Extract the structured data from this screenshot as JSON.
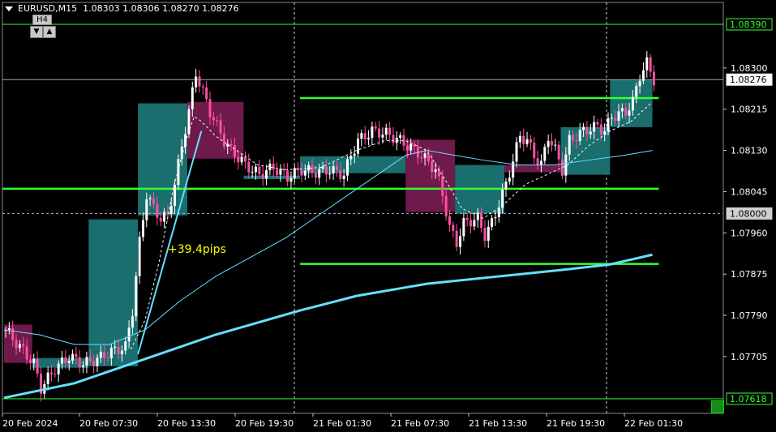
{
  "header": {
    "symbol_tf": "EURUSD,M15",
    "ohlc": "1.08303 1.08306 1.08270 1.08276"
  },
  "timeframe_button": {
    "label": "H4",
    "down_glyph": "▼",
    "up_glyph": "▲"
  },
  "annotation": {
    "text": "+39.4pips",
    "color": "#ffff00"
  },
  "colors": {
    "background": "#000000",
    "bull_candle": "#ffffff",
    "bear_candle": "#ff4fa3",
    "bull_box": "#1a6e6e",
    "bear_box": "#6e1a4a",
    "ma_color": "#66e0ff",
    "level_line": "#33ff33",
    "price_line": "#9aa7b8"
  },
  "chart_data": {
    "type": "candlestick",
    "symbol": "EURUSD",
    "timeframe": "M15",
    "ylim": [
      1.0758,
      1.0847
    ],
    "y_ticks": [
      "1.08300",
      "1.08215",
      "1.08130",
      "1.08045",
      "1.07960",
      "1.07875",
      "1.07790",
      "1.07705"
    ],
    "x_tick_labels": [
      "20 Feb 2024",
      "20 Feb 07:30",
      "20 Feb 13:30",
      "20 Feb 19:30",
      "21 Feb 01:30",
      "21 Feb 07:30",
      "21 Feb 13:30",
      "21 Feb 19:30",
      "22 Feb 01:30"
    ],
    "price_labels": [
      {
        "text": "1.08390",
        "value": 1.0839,
        "style": "green"
      },
      {
        "text": "1.08276",
        "value": 1.08276,
        "style": "current"
      },
      {
        "text": "1.08000",
        "value": 1.08,
        "style": "gray"
      },
      {
        "text": "1.07618",
        "value": 1.07618,
        "style": "green"
      }
    ],
    "horizontal_levels": [
      {
        "value": 1.0839,
        "kind": "thin-green"
      },
      {
        "value": 1.07618,
        "kind": "thin-green"
      },
      {
        "value": 1.08051,
        "kind": "bold-green",
        "from_bar": 0,
        "to_bar": 184
      },
      {
        "value": 1.08238,
        "kind": "bold-green",
        "from_bar": 84,
        "to_bar": 184
      },
      {
        "value": 1.07896,
        "kind": "bold-green",
        "from_bar": 84,
        "to_bar": 184
      },
      {
        "value": 1.08276,
        "kind": "price-line"
      },
      {
        "value": 1.08,
        "kind": "dotted"
      }
    ],
    "h4_boxes": [
      {
        "from_bar": 0,
        "to_bar": 8,
        "open": 1.07771,
        "close": 1.07692,
        "high": 1.078,
        "low": 1.0762
      },
      {
        "from_bar": 8,
        "to_bar": 24,
        "open": 1.07682,
        "close": 1.07702,
        "high": 1.0772,
        "low": 1.0764
      },
      {
        "from_bar": 24,
        "to_bar": 38,
        "open": 1.07685,
        "close": 1.07988,
        "high": 1.08,
        "low": 1.0768
      },
      {
        "from_bar": 38,
        "to_bar": 52,
        "open": 1.07996,
        "close": 1.08227,
        "high": 1.0838,
        "low": 1.0795
      },
      {
        "from_bar": 52,
        "to_bar": 68,
        "open": 1.0823,
        "close": 1.08113,
        "high": 1.08305,
        "low": 1.0808
      },
      {
        "from_bar": 68,
        "to_bar": 84,
        "open": 1.08071,
        "close": 1.08078,
        "high": 1.0812,
        "low": 1.0805
      },
      {
        "from_bar": 84,
        "to_bar": 114,
        "open": 1.08083,
        "close": 1.08118,
        "high": 1.0818,
        "low": 1.0804
      },
      {
        "from_bar": 114,
        "to_bar": 128,
        "open": 1.08152,
        "close": 1.08003,
        "high": 1.0817,
        "low": 1.0789
      },
      {
        "from_bar": 128,
        "to_bar": 142,
        "open": 1.08,
        "close": 1.081,
        "high": 1.0816,
        "low": 1.079
      },
      {
        "from_bar": 142,
        "to_bar": 158,
        "open": 1.081,
        "close": 1.08085,
        "high": 1.0819,
        "low": 1.0803
      },
      {
        "from_bar": 158,
        "to_bar": 172,
        "open": 1.0808,
        "close": 1.08178,
        "high": 1.0824,
        "low": 1.08
      },
      {
        "from_bar": 172,
        "to_bar": 184,
        "open": 1.08178,
        "close": 1.08276,
        "high": 1.0833,
        "low": 1.0812
      }
    ],
    "close_path": [
      [
        0,
        1.0776
      ],
      [
        4,
        1.07725
      ],
      [
        8,
        1.0769
      ],
      [
        10,
        1.0764
      ],
      [
        14,
        1.0768
      ],
      [
        18,
        1.07705
      ],
      [
        22,
        1.0769
      ],
      [
        26,
        1.077
      ],
      [
        30,
        1.07715
      ],
      [
        34,
        1.07725
      ],
      [
        36,
        1.078
      ],
      [
        38,
        1.0794
      ],
      [
        40,
        1.0804
      ],
      [
        42,
        1.0801
      ],
      [
        44,
        1.0799
      ],
      [
        46,
        1.07995
      ],
      [
        48,
        1.0806
      ],
      [
        50,
        1.0814
      ],
      [
        52,
        1.0821
      ],
      [
        54,
        1.0829
      ],
      [
        56,
        1.0825
      ],
      [
        58,
        1.0821
      ],
      [
        60,
        1.0818
      ],
      [
        62,
        1.0815
      ],
      [
        64,
        1.0813
      ],
      [
        66,
        1.08115
      ],
      [
        68,
        1.081
      ],
      [
        70,
        1.0809
      ],
      [
        72,
        1.0808
      ],
      [
        76,
        1.08095
      ],
      [
        80,
        1.08075
      ],
      [
        84,
        1.0809
      ],
      [
        88,
        1.08085
      ],
      [
        92,
        1.0809
      ],
      [
        96,
        1.0808
      ],
      [
        98,
        1.0812
      ],
      [
        100,
        1.0815
      ],
      [
        104,
        1.0817
      ],
      [
        108,
        1.08165
      ],
      [
        112,
        1.0815
      ],
      [
        114,
        1.0814
      ],
      [
        118,
        1.0812
      ],
      [
        122,
        1.0809
      ],
      [
        124,
        1.0804
      ],
      [
        126,
        1.0797
      ],
      [
        128,
        1.0794
      ],
      [
        130,
        1.0798
      ],
      [
        134,
        1.0799
      ],
      [
        136,
        1.07955
      ],
      [
        138,
        1.0798
      ],
      [
        140,
        1.0802
      ],
      [
        142,
        1.0806
      ],
      [
        144,
        1.0811
      ],
      [
        146,
        1.0816
      ],
      [
        148,
        1.0815
      ],
      [
        150,
        1.0812
      ],
      [
        152,
        1.081
      ],
      [
        154,
        1.0816
      ],
      [
        156,
        1.0813
      ],
      [
        158,
        1.0809
      ],
      [
        160,
        1.0815
      ],
      [
        164,
        1.0817
      ],
      [
        168,
        1.0818
      ],
      [
        170,
        1.0817
      ],
      [
        172,
        1.082
      ],
      [
        176,
        1.0821
      ],
      [
        178,
        1.0823
      ],
      [
        180,
        1.08285
      ],
      [
        182,
        1.0831
      ],
      [
        184,
        1.08276
      ]
    ],
    "ma_fast": [
      [
        36,
        1.0772
      ],
      [
        40,
        1.0778
      ],
      [
        44,
        1.079
      ],
      [
        48,
        1.0805
      ],
      [
        52,
        1.0816
      ],
      [
        54,
        1.082
      ],
      [
        56,
        1.0819
      ],
      [
        60,
        1.0816
      ],
      [
        64,
        1.0814
      ],
      [
        68,
        1.0812
      ],
      [
        72,
        1.081
      ],
      [
        80,
        1.0809
      ],
      [
        90,
        1.08095
      ],
      [
        100,
        1.0813
      ],
      [
        108,
        1.0815
      ],
      [
        114,
        1.0815
      ],
      [
        120,
        1.0813
      ],
      [
        126,
        1.0806
      ],
      [
        130,
        1.0801
      ],
      [
        136,
        1.0799
      ],
      [
        142,
        1.0802
      ],
      [
        148,
        1.0806
      ],
      [
        154,
        1.0808
      ],
      [
        160,
        1.081
      ],
      [
        166,
        1.0814
      ],
      [
        172,
        1.0817
      ],
      [
        178,
        1.0819
      ],
      [
        184,
        1.0823
      ]
    ],
    "ma_mid": [
      [
        0,
        1.0776
      ],
      [
        10,
        1.0775
      ],
      [
        20,
        1.0773
      ],
      [
        30,
        1.0773
      ],
      [
        40,
        1.0776
      ],
      [
        50,
        1.0782
      ],
      [
        60,
        1.0787
      ],
      [
        70,
        1.0791
      ],
      [
        80,
        1.0795
      ],
      [
        90,
        1.08
      ],
      [
        100,
        1.0805
      ],
      [
        108,
        1.0809
      ],
      [
        114,
        1.0812
      ],
      [
        120,
        1.0813
      ],
      [
        128,
        1.0812
      ],
      [
        136,
        1.0811
      ],
      [
        146,
        1.081
      ],
      [
        156,
        1.081
      ],
      [
        166,
        1.0811
      ],
      [
        176,
        1.0812
      ],
      [
        184,
        1.0813
      ]
    ],
    "ma_slow": [
      [
        0,
        1.0762
      ],
      [
        20,
        1.0765
      ],
      [
        40,
        1.077
      ],
      [
        60,
        1.0775
      ],
      [
        84,
        1.078
      ],
      [
        100,
        1.0783
      ],
      [
        120,
        1.07855
      ],
      [
        140,
        1.0787
      ],
      [
        160,
        1.07885
      ],
      [
        172,
        1.07895
      ],
      [
        184,
        1.07915
      ]
    ],
    "trend_line": {
      "from": [
        38,
        1.0771
      ],
      "to": [
        56,
        1.0817
      ]
    }
  }
}
